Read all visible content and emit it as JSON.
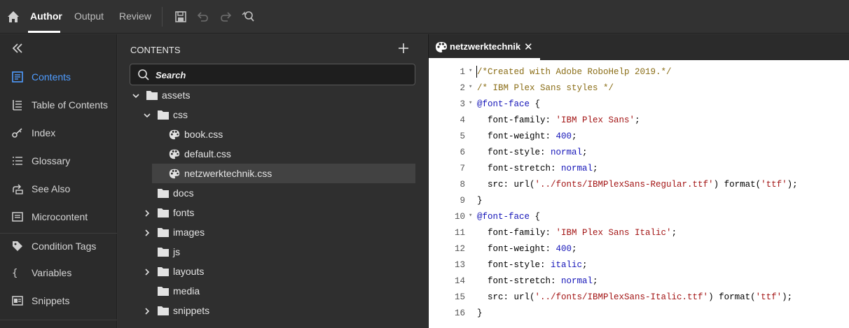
{
  "topbar": {
    "tabs": [
      {
        "label": "Author",
        "active": true
      },
      {
        "label": "Output",
        "active": false
      },
      {
        "label": "Review",
        "active": false
      }
    ],
    "tools": [
      "save-icon",
      "undo-icon",
      "redo-icon",
      "find-replace-icon"
    ]
  },
  "leftnav": {
    "items": [
      {
        "label": "Contents",
        "icon": "contents-icon",
        "active": true
      },
      {
        "label": "Table of Contents",
        "icon": "toc-icon",
        "active": false
      },
      {
        "label": "Index",
        "icon": "index-key-icon",
        "active": false
      },
      {
        "label": "Glossary",
        "icon": "glossary-list-icon",
        "active": false
      },
      {
        "label": "See Also",
        "icon": "see-also-icon",
        "active": false
      },
      {
        "label": "Microcontent",
        "icon": "microcontent-icon",
        "active": false
      },
      {
        "label": "Condition Tags",
        "icon": "tag-icon",
        "active": false
      },
      {
        "label": "Variables",
        "icon": "braces-icon",
        "active": false
      },
      {
        "label": "Snippets",
        "icon": "snippet-icon",
        "active": false
      }
    ]
  },
  "contents": {
    "header": "CONTENTS",
    "search_placeholder": "Search",
    "tree": [
      {
        "label": "assets",
        "type": "folder",
        "expanded": true
      },
      {
        "label": "css",
        "type": "folder",
        "expanded": true
      },
      {
        "label": "book.css",
        "type": "css-file"
      },
      {
        "label": "default.css",
        "type": "css-file"
      },
      {
        "label": "netzwerktechnik.css",
        "type": "css-file",
        "selected": true
      },
      {
        "label": "docs",
        "type": "folder"
      },
      {
        "label": "fonts",
        "type": "folder",
        "expanded": false
      },
      {
        "label": "images",
        "type": "folder",
        "expanded": false
      },
      {
        "label": "js",
        "type": "folder"
      },
      {
        "label": "layouts",
        "type": "folder",
        "expanded": false
      },
      {
        "label": "media",
        "type": "folder"
      },
      {
        "label": "snippets",
        "type": "folder",
        "expanded": false
      }
    ]
  },
  "editor": {
    "tab_label": "netzwerktechnik",
    "close_glyph": "✕",
    "lines": [
      {
        "n": "1",
        "fold": true,
        "text": "/*Created with Adobe RoboHelp 2019.*/"
      },
      {
        "n": "2",
        "fold": true,
        "text": "/* IBM Plex Sans styles */"
      },
      {
        "n": "3",
        "fold": true,
        "text": "@font-face {"
      },
      {
        "n": "4",
        "fold": false,
        "text": "  font-family: 'IBM Plex Sans';"
      },
      {
        "n": "5",
        "fold": false,
        "text": "  font-weight: 400;"
      },
      {
        "n": "6",
        "fold": false,
        "text": "  font-style: normal;"
      },
      {
        "n": "7",
        "fold": false,
        "text": "  font-stretch: normal;"
      },
      {
        "n": "8",
        "fold": false,
        "text": "  src: url('../fonts/IBMPlexSans-Regular.ttf') format('ttf');"
      },
      {
        "n": "9",
        "fold": false,
        "text": "}"
      },
      {
        "n": "10",
        "fold": true,
        "text": "@font-face {"
      },
      {
        "n": "11",
        "fold": false,
        "text": "  font-family: 'IBM Plex Sans Italic';"
      },
      {
        "n": "12",
        "fold": false,
        "text": "  font-weight: 400;"
      },
      {
        "n": "13",
        "fold": false,
        "text": "  font-style: italic;"
      },
      {
        "n": "14",
        "fold": false,
        "text": "  font-stretch: normal;"
      },
      {
        "n": "15",
        "fold": false,
        "text": "  src: url('../fonts/IBMPlexSans-Italic.ttf') format('ttf');"
      },
      {
        "n": "16",
        "fold": false,
        "text": "}"
      }
    ]
  },
  "colors": {
    "accent": "#4f9cff",
    "comment": "#8a6d16",
    "string": "#a31515",
    "keyword": "#1515b8"
  }
}
